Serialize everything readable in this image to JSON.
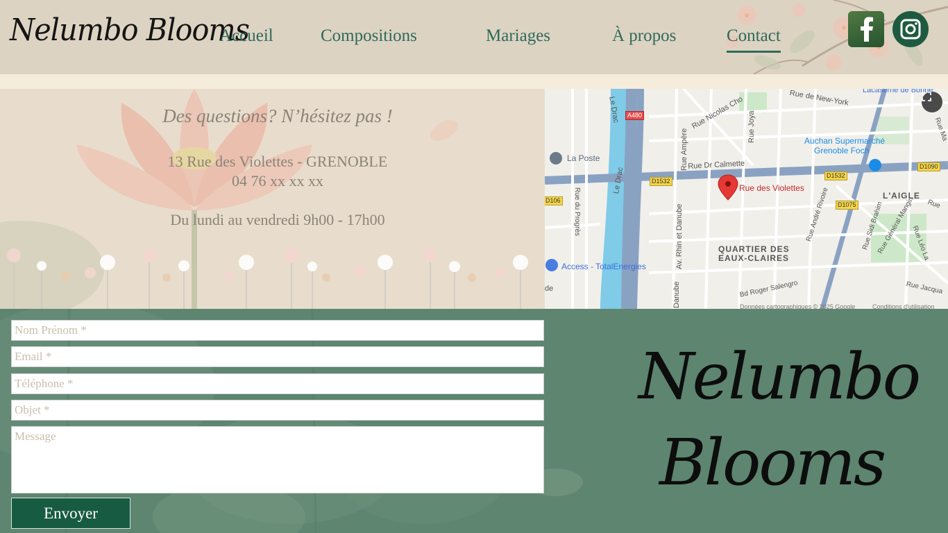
{
  "brand": {
    "name": "Nelumbo Blooms",
    "big_line1": "Nelumbo",
    "big_line2": "Blooms"
  },
  "nav": {
    "items": [
      {
        "label": "Accueil",
        "active": false
      },
      {
        "label": "Compositions",
        "active": false
      },
      {
        "label": "Mariages",
        "active": false
      },
      {
        "label": "À propos",
        "active": false
      },
      {
        "label": "Contact",
        "active": true
      }
    ]
  },
  "social": {
    "facebook_icon": "facebook-icon",
    "instagram_icon": "instagram-icon"
  },
  "info": {
    "tagline": "Des questions? N’hésitez pas !",
    "address": "13 Rue des Violettes - GRENOBLE",
    "phone": "04 76 xx xx xx",
    "hours": "Du lundi au vendredi 9h00 - 17h00"
  },
  "map": {
    "labels": {
      "la_poste": "La Poste",
      "access_total": "Access - TotalEnergies",
      "rue_violettes": "Rue des Violettes",
      "auchan1": "Auchan Supermarché",
      "auchan2": "Grenoble Foch",
      "laigle": "L'AIGLE",
      "quartier1": "QUARTIER DES",
      "quartier2": "EAUX-CLAIRES",
      "rue_new_york": "Rue de New-York",
      "caserne": "Lacaserne de Bonne",
      "rue_nicolas": "Rue Nicolas Cho",
      "rue_joya": "Rue Joya",
      "rue_ampere": "Rue Ampère",
      "rue_dr_calmette": "Rue Dr Calmette",
      "le_drac_1": "Le Drac",
      "le_drac_2": "Le Drac",
      "rue_progres": "Rue du Progrès",
      "av_rhin": "Av. Rhin et Danube",
      "danube": "Danube",
      "rue_andre_rivoire": "Rue André Rivoire",
      "rue_sidi_brahim": "Rue Sidi Brahim",
      "rue_general_mangin": "Rue Général Mangin",
      "rue_leo_la": "Rue Léo La",
      "bd_roger": "Bd Roger Salengro",
      "rue_jacqua": "Rue Jacqua",
      "rue_ma": "Rue Ma",
      "rue_edge": "Rue",
      "de": "de",
      "copyright": "Données cartographiques © 2025 Google",
      "conditions": "Conditions d'utilisation"
    },
    "shields": {
      "a480": "A480",
      "d1532_a": "D1532",
      "d1532_b": "D1532",
      "d1090": "D1090",
      "d1075": "D1075",
      "d106": "D106"
    }
  },
  "form": {
    "name_placeholder": "Nom Prénom *",
    "email_placeholder": "Email *",
    "phone_placeholder": "Téléphone *",
    "subject_placeholder": "Objet *",
    "message_placeholder": "Message",
    "submit_label": "Envoyer"
  },
  "colors": {
    "accent_green": "#2e6a5a",
    "form_bg": "#5d8570",
    "button_bg": "#175b42"
  }
}
